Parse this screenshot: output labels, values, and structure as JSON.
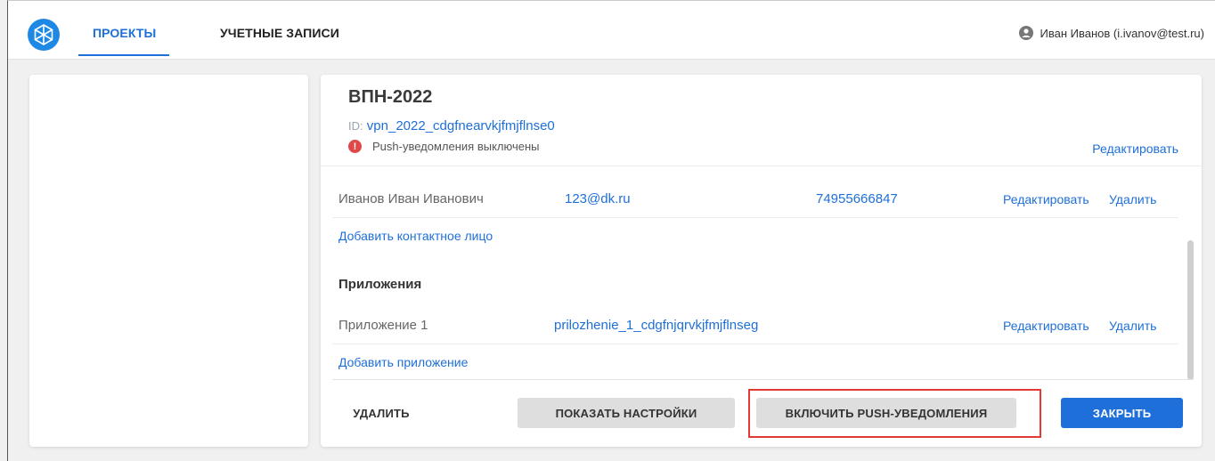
{
  "topbar": {
    "tabs": [
      {
        "label": "ПРОЕКТЫ",
        "active": true
      },
      {
        "label": "УЧЕТНЫЕ ЗАПИСИ",
        "active": false
      }
    ],
    "user_label": "Иван Иванов (i.ivanov@test.ru)"
  },
  "project": {
    "title": "ВПН-2022",
    "id_label": "ID:",
    "id_value": "vpn_2022_cdgfnearvkjfmjflnse0",
    "status": "Push-уведомления выключены",
    "edit_label": "Редактировать"
  },
  "contacts": {
    "rows": [
      {
        "name": "Иванов Иван Иванович",
        "email": "123@dk.ru",
        "phone": "74955666847",
        "edit": "Редактировать",
        "delete": "Удалить"
      }
    ],
    "add_label": "Добавить контактное лицо"
  },
  "apps": {
    "section_title": "Приложения",
    "rows": [
      {
        "name": "Приложение 1",
        "id": "prilozhenie_1_cdgfnjqrvkjfmjflnseg",
        "edit": "Редактировать",
        "delete": "Удалить"
      }
    ],
    "add_label": "Добавить приложение"
  },
  "footer": {
    "delete_label": "УДАЛИТЬ",
    "settings_label": "ПОКАЗАТЬ НАСТРОЙКИ",
    "push_label": "ВКЛЮЧИТЬ PUSH-УВЕДОМЛЕНИЯ",
    "close_label": "ЗАКРЫТЬ"
  },
  "colors": {
    "accent": "#1e6fd9",
    "warning": "#e04848",
    "highlight": "#e53935"
  }
}
